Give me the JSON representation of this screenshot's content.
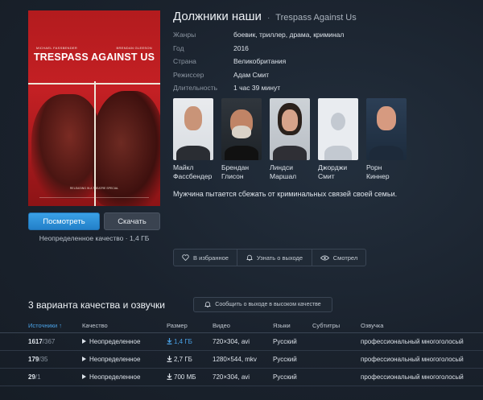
{
  "movie": {
    "title_ru": "Должники наши",
    "title_separator": "·",
    "title_original": "Trespass Against Us",
    "poster": {
      "actor1": "MICHAEL FASSBENDER",
      "actor2": "BRENDAN GLEESON",
      "title": "TRESPASS AGAINST US",
      "tagline": "RELEASING IN A THEATRE SPECIAL"
    },
    "info": [
      {
        "label": "Жанры",
        "value": "боевик, триллер, драма, криминал"
      },
      {
        "label": "Год",
        "value": "2016"
      },
      {
        "label": "Страна",
        "value": "Великобритания"
      },
      {
        "label": "Режиссер",
        "value": "Адам Смит"
      },
      {
        "label": "Длительность",
        "value": "1 час 39 минут"
      }
    ],
    "cast": [
      {
        "first": "Майкл",
        "last": "Фассбендер"
      },
      {
        "first": "Брендан",
        "last": "Глисон"
      },
      {
        "first": "Линдси",
        "last": "Маршал"
      },
      {
        "first": "Джорджи",
        "last": "Смит"
      },
      {
        "first": "Рорн",
        "last": "Киннер"
      }
    ],
    "description": "Мужчина пытается сбежать от криминальных связей своей семьи."
  },
  "buttons": {
    "watch": "Посмотреть",
    "download": "Скачать",
    "quality_note": "Неопределенное качество · 1,4 ГБ"
  },
  "actions": {
    "favorite": "В избранное",
    "notify": "Узнать о выходе",
    "watched": "Смотрел"
  },
  "variants": {
    "title": "3 варианта качества и озвучки",
    "notify_hq": "Сообщить о выходе в высоком качестве",
    "columns": {
      "sources": "Источники ↑",
      "quality": "Качество",
      "size": "Размер",
      "video": "Видео",
      "languages": "Языки",
      "subtitles": "Субтитры",
      "voice": "Озвучка"
    },
    "rows": [
      {
        "seeds": "1617",
        "peers": "/367",
        "quality": "Неопределенное",
        "size": "1,4 ГБ",
        "video": "720×304, avi",
        "lang": "Русский",
        "subs": "",
        "voice": "профессиональный многоголосый"
      },
      {
        "seeds": "179",
        "peers": "/35",
        "quality": "Неопределенное",
        "size": "2,7 ГБ",
        "video": "1280×544, mkv",
        "lang": "Русский",
        "subs": "",
        "voice": "профессиональный многоголосый"
      },
      {
        "seeds": "29",
        "peers": "/1",
        "quality": "Неопределенное",
        "size": "700 МБ",
        "video": "720×304, avi",
        "lang": "Русский",
        "subs": "",
        "voice": "профессиональный многоголосый"
      }
    ]
  },
  "colors": {
    "background": "#1b2430",
    "accent": "#2e8fd8",
    "poster_red": "#c42024"
  }
}
